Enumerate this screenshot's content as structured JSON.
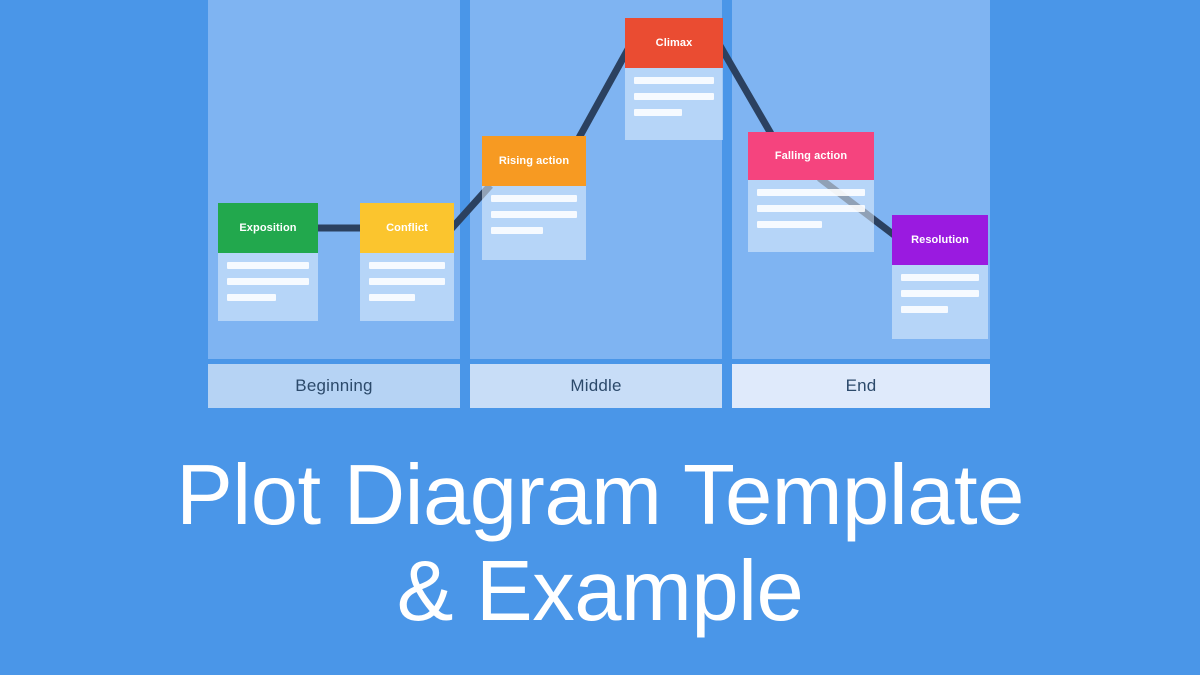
{
  "page": {
    "background_color": "#4a96e8",
    "title_lines": [
      "Plot Diagram Template",
      "& Example"
    ],
    "title_color": "#ffffff"
  },
  "diagram": {
    "connector_color": "#2b4160",
    "panel_color": "#7fb4f2",
    "acts": [
      {
        "id": "beginning",
        "label": "Beginning",
        "footer_color": "#b6d3f4"
      },
      {
        "id": "middle",
        "label": "Middle",
        "footer_color": "#c8ddf7"
      },
      {
        "id": "end",
        "label": "End",
        "footer_color": "#dfeafb"
      }
    ],
    "stages": [
      {
        "id": "exposition",
        "label": "Exposition",
        "color": "#22a84d",
        "act": "beginning",
        "line_widths": [
          "w100",
          "w100",
          "w60"
        ]
      },
      {
        "id": "conflict",
        "label": "Conflict",
        "color": "#fbc52e",
        "act": "beginning",
        "line_widths": [
          "w100",
          "w100",
          "w60"
        ]
      },
      {
        "id": "rising-action",
        "label": "Rising action",
        "color": "#f79a22",
        "act": "middle",
        "line_widths": [
          "w100",
          "w100",
          "w60"
        ]
      },
      {
        "id": "climax",
        "label": "Climax",
        "color": "#ea4c32",
        "act": "middle",
        "line_widths": [
          "w100",
          "w100",
          "w60"
        ]
      },
      {
        "id": "falling-action",
        "label": "Falling action",
        "color": "#f5447e",
        "act": "end",
        "line_widths": [
          "w100",
          "w100",
          "w60"
        ]
      },
      {
        "id": "resolution",
        "label": "Resolution",
        "color": "#9a1ae0",
        "act": "end",
        "line_widths": [
          "w100",
          "w100",
          "w60"
        ]
      }
    ]
  }
}
